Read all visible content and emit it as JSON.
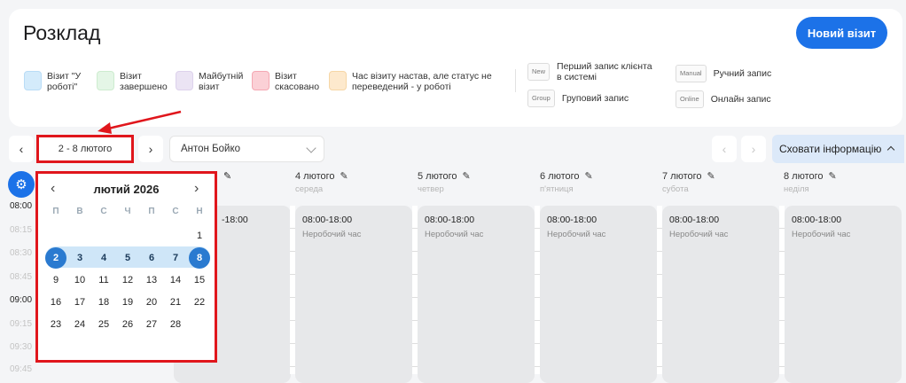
{
  "header": {
    "title": "Розклад",
    "new_visit_label": "Новий візит"
  },
  "legend": [
    {
      "label": "Візит \"У роботі\"",
      "color": "#d4ebfb"
    },
    {
      "label": "Візит завершено",
      "color": "#e4f6e6"
    },
    {
      "label": "Майбутній візит",
      "color": "#ebe4f4"
    },
    {
      "label": "Візит скасовано",
      "color": "#fbd0d6"
    },
    {
      "label": "Час візиту настав, але статус не переведений - у роботі",
      "color": "#fde9cd"
    }
  ],
  "tags": [
    {
      "tag": "New",
      "label": "Перший запис клієнта в системі"
    },
    {
      "tag": "Group",
      "label": "Груповий запис"
    },
    {
      "tag": "Manual",
      "label": "Ручний запис"
    },
    {
      "tag": "Online",
      "label": "Онлайн запис"
    }
  ],
  "toolbar": {
    "prev": "‹",
    "next": "›",
    "range": "2 - 8 лютого",
    "doctor": "Антон Бойко",
    "hide_info": "Сховати інформацію"
  },
  "days": [
    {
      "date": "4 лютого",
      "weekday": "середа"
    },
    {
      "date": "5 лютого",
      "weekday": "четвер"
    },
    {
      "date": "6 лютого",
      "weekday": "п'ятниця"
    },
    {
      "date": "7 лютого",
      "weekday": "субота"
    },
    {
      "date": "8 лютого",
      "weekday": "неділя"
    }
  ],
  "day_cols": [
    {
      "hours": "08:00-18:00",
      "status": "Неробочий час"
    },
    {
      "hours": "08:00-18:00",
      "status": "Неробочий час"
    },
    {
      "hours": "08:00-18:00",
      "status": "Неробочий час"
    },
    {
      "hours": "08:00-18:00",
      "status": "Неробочий час"
    },
    {
      "hours": "08:00-18:00",
      "status": "Неробочий час"
    }
  ],
  "partial_hours": "-18:00",
  "times": [
    "08:00",
    "08:15",
    "08:30",
    "08:45",
    "09:00",
    "09:15",
    "09:30",
    "09:45"
  ],
  "calendar": {
    "month": "лютий 2026",
    "weekdays": [
      "П",
      "В",
      "С",
      "Ч",
      "П",
      "С",
      "Н"
    ],
    "rows": [
      [
        "",
        "",
        "",
        "",
        "",
        "",
        "1"
      ],
      [
        "2",
        "3",
        "4",
        "5",
        "6",
        "7",
        "8"
      ],
      [
        "9",
        "10",
        "11",
        "12",
        "13",
        "14",
        "15"
      ],
      [
        "16",
        "17",
        "18",
        "19",
        "20",
        "21",
        "22"
      ],
      [
        "23",
        "24",
        "25",
        "26",
        "27",
        "28",
        ""
      ]
    ]
  }
}
